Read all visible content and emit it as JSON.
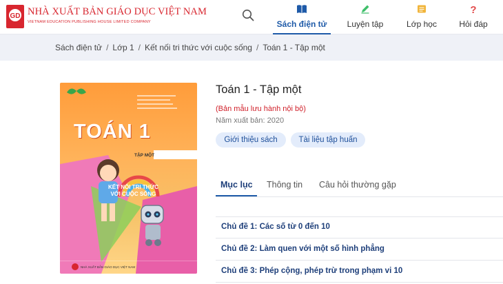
{
  "header": {
    "brand_name": "NHÀ XUẤT BẢN GIÁO DỤC VIỆT NAM",
    "brand_sub": "VIETNAM EDUCATION PUBLISHING HOUSE LIMITED COMPANY",
    "brand_color": "#d8262f",
    "accent_color": "#1e5aa8",
    "search_icon": "search-icon",
    "nav": [
      {
        "label": "Sách điện tử",
        "icon": "book-icon",
        "active": true
      },
      {
        "label": "Luyện tập",
        "icon": "pencil-icon",
        "active": false
      },
      {
        "label": "Lớp học",
        "icon": "notebook-icon",
        "active": false
      },
      {
        "label": "Hỏi đáp",
        "icon": "question-icon",
        "active": false
      }
    ]
  },
  "breadcrumb": [
    "Sách điện tử",
    "Lớp 1",
    "Kết nối tri thức với cuộc sống",
    "Toán 1 - Tập một"
  ],
  "book": {
    "title": "Toán 1 - Tập một",
    "note": "(Bản mẫu lưu hành nội bộ)",
    "year_label": "Năm xuất bản:",
    "year": "2020",
    "buttons": [
      "Giới thiệu sách",
      "Tài liệu tập huấn"
    ]
  },
  "cover": {
    "title": "TOÁN 1",
    "volume": "TẬP MỘT",
    "tagline_1": "KẾT NỐI TRI THỨC",
    "tagline_2": "VỚI CUỘC SỐNG",
    "publisher": "NHÀ XUẤT BẢN GIÁO DỤC VIỆT NAM"
  },
  "tabs": [
    "Mục lục",
    "Thông tin",
    "Câu hỏi thường gặp"
  ],
  "chapters": [
    "Chủ đề 1: Các số từ 0 đến 10",
    "Chủ đề 2: Làm quen với một số hình phẳng",
    "Chủ đề 3: Phép cộng, phép trừ trong phạm vi 10"
  ]
}
